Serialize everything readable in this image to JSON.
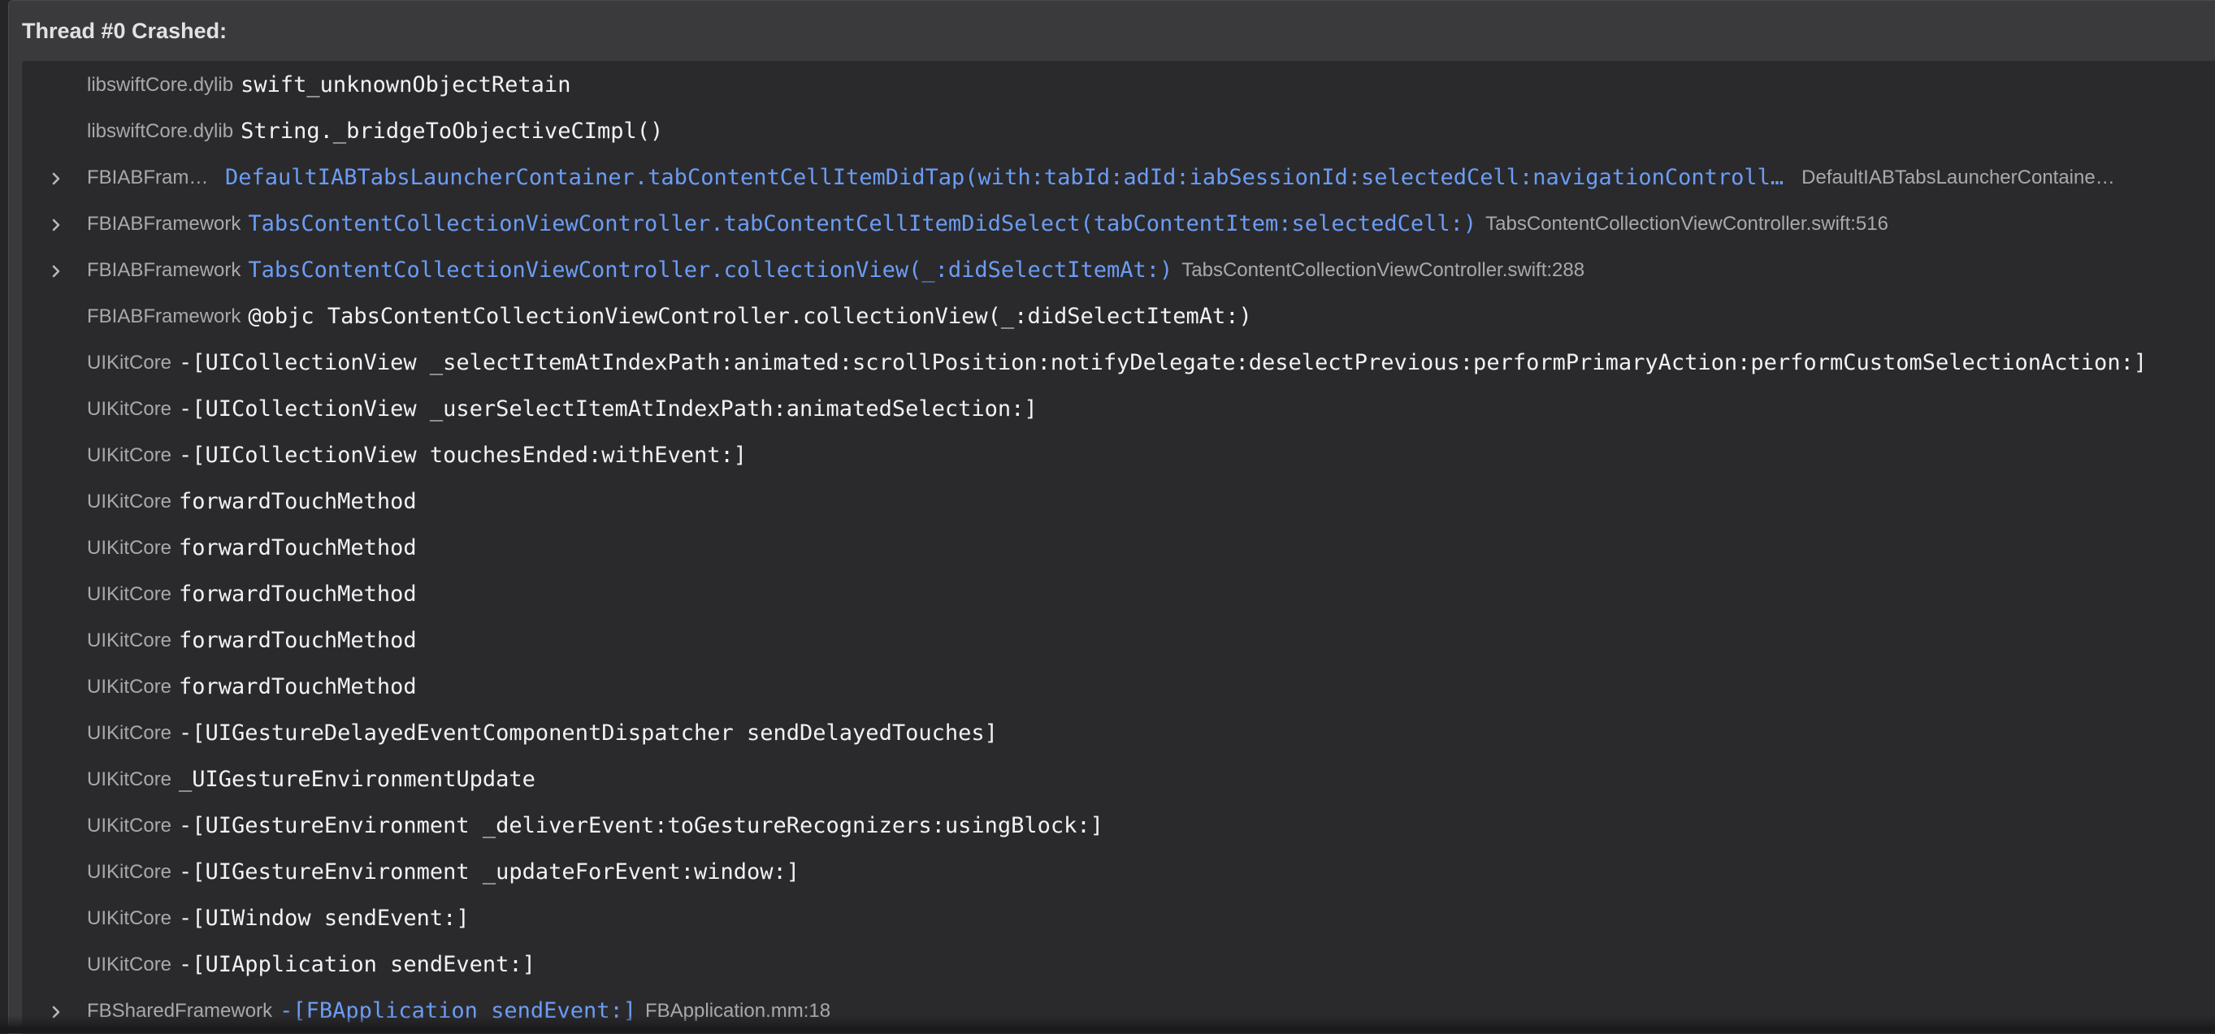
{
  "title": "Thread #0 Crashed:",
  "frames": [
    {
      "lib": "libswiftCore.dylib",
      "symbol": "swift_unknownObjectRetain",
      "file": "",
      "expandable": false
    },
    {
      "lib": "libswiftCore.dylib",
      "symbol": "String._bridgeToObjectiveCImpl()",
      "file": "",
      "expandable": false
    },
    {
      "lib": "FBIABFrame…",
      "symbol": "DefaultIABTabsLauncherContainer.tabContentCellItemDidTap(with:tabId:adId:iabSessionId:selectedCell:navigationControll…",
      "file": "DefaultIABTabsLauncherContaine…",
      "expandable": true
    },
    {
      "lib": "FBIABFramework",
      "symbol": "TabsContentCollectionViewController.tabContentCellItemDidSelect(tabContentItem:selectedCell:)",
      "file": "TabsContentCollectionViewController.swift:516",
      "expandable": true
    },
    {
      "lib": "FBIABFramework",
      "symbol": "TabsContentCollectionViewController.collectionView(_:didSelectItemAt:)",
      "file": "TabsContentCollectionViewController.swift:288",
      "expandable": true
    },
    {
      "lib": "FBIABFramework",
      "symbol": "@objc TabsContentCollectionViewController.collectionView(_:didSelectItemAt:)",
      "file": "",
      "expandable": false
    },
    {
      "lib": "UIKitCore",
      "symbol": "-[UICollectionView _selectItemAtIndexPath:animated:scrollPosition:notifyDelegate:deselectPrevious:performPrimaryAction:performCustomSelectionAction:]",
      "file": "",
      "expandable": false
    },
    {
      "lib": "UIKitCore",
      "symbol": "-[UICollectionView _userSelectItemAtIndexPath:animatedSelection:]",
      "file": "",
      "expandable": false
    },
    {
      "lib": "UIKitCore",
      "symbol": "-[UICollectionView touchesEnded:withEvent:]",
      "file": "",
      "expandable": false
    },
    {
      "lib": "UIKitCore",
      "symbol": "forwardTouchMethod",
      "file": "",
      "expandable": false
    },
    {
      "lib": "UIKitCore",
      "symbol": "forwardTouchMethod",
      "file": "",
      "expandable": false
    },
    {
      "lib": "UIKitCore",
      "symbol": "forwardTouchMethod",
      "file": "",
      "expandable": false
    },
    {
      "lib": "UIKitCore",
      "symbol": "forwardTouchMethod",
      "file": "",
      "expandable": false
    },
    {
      "lib": "UIKitCore",
      "symbol": "forwardTouchMethod",
      "file": "",
      "expandable": false
    },
    {
      "lib": "UIKitCore",
      "symbol": "-[UIGestureDelayedEventComponentDispatcher sendDelayedTouches]",
      "file": "",
      "expandable": false
    },
    {
      "lib": "UIKitCore",
      "symbol": "_UIGestureEnvironmentUpdate",
      "file": "",
      "expandable": false
    },
    {
      "lib": "UIKitCore",
      "symbol": "-[UIGestureEnvironment _deliverEvent:toGestureRecognizers:usingBlock:]",
      "file": "",
      "expandable": false
    },
    {
      "lib": "UIKitCore",
      "symbol": "-[UIGestureEnvironment _updateForEvent:window:]",
      "file": "",
      "expandable": false
    },
    {
      "lib": "UIKitCore",
      "symbol": "-[UIWindow sendEvent:]",
      "file": "",
      "expandable": false
    },
    {
      "lib": "UIKitCore",
      "symbol": "-[UIApplication sendEvent:]",
      "file": "",
      "expandable": false
    },
    {
      "lib": "FBSharedFramework",
      "symbol": "-[FBApplication sendEvent:]",
      "file": "FBApplication.mm:18",
      "expandable": true
    }
  ],
  "colors": {
    "link": "#6c9cf5",
    "symbol": "#f2f2f4",
    "secondary": "#a9a9ad",
    "panel": "#2a2a2c",
    "header": "#3a3a3c"
  }
}
